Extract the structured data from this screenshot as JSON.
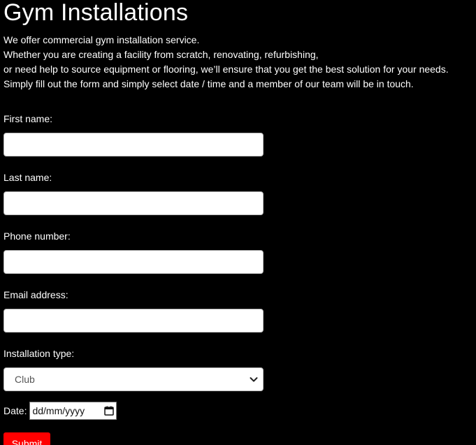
{
  "page": {
    "title": "Gym Installations",
    "intro": [
      "We offer commercial gym installation service.",
      "Whether you are creating a facility from scratch, renovating, refurbishing,",
      "or need help to source equipment or flooring, we’ll ensure that you get the best solution for your needs.",
      "Simply fill out the form and simply select date / time and a member of our team will be in touch."
    ]
  },
  "form": {
    "first_name_label": "First name:",
    "first_name_value": "",
    "last_name_label": "Last name:",
    "last_name_value": "",
    "phone_label": "Phone number:",
    "phone_value": "",
    "email_label": "Email address:",
    "email_value": "",
    "installation_label": "Installation type:",
    "installation_selected": "Club",
    "date_label": "Date:",
    "date_placeholder": "dd/mm/yyyy",
    "submit_label": "Submit"
  },
  "icons": {
    "select_arrow": "chevron-down-icon",
    "date_picker": "calendar-icon"
  },
  "colors": {
    "background": "#000000",
    "text": "#ffffff",
    "submit": "#ff0000"
  }
}
